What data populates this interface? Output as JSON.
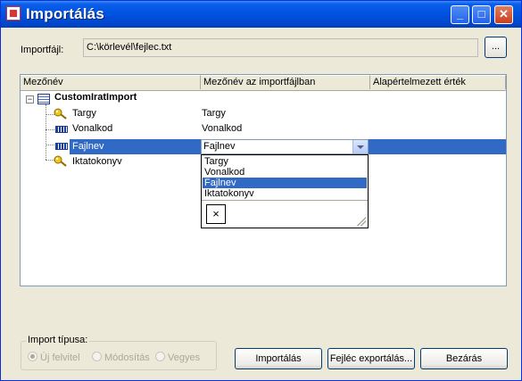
{
  "window": {
    "title": "Importálás"
  },
  "titlebar_buttons": {
    "minimize": "_",
    "maximize": "□",
    "close": "✕"
  },
  "import_file": {
    "label": "Importfájl:",
    "value": "C:\\körlevél\\fejlec.txt",
    "browse_label": "..."
  },
  "grid": {
    "columns": [
      "Mezőnév",
      "Mezőnév az importfájlban",
      "Alapértelmezett érték"
    ],
    "root": "CustomIratImport",
    "rows": [
      {
        "name": "Targy",
        "icon": "key-icon",
        "import_name": "Targy"
      },
      {
        "name": "Vonalkod",
        "icon": "field-icon",
        "import_name": "Vonalkod"
      },
      {
        "name": "Fajlnev",
        "icon": "field-icon",
        "import_name": "Fajlnev",
        "selected": true
      },
      {
        "name": "Iktatokonyv",
        "icon": "key-icon",
        "import_name": ""
      }
    ],
    "dropdown_options": [
      "Targy",
      "Vonalkod",
      "Fajlnev",
      "Iktatokonyv"
    ],
    "dropdown_selected": "Fajlnev",
    "dropdown_clear": "×"
  },
  "import_type": {
    "legend": "Import típusa:",
    "options": [
      "Új felvitel",
      "Módosítás",
      "Vegyes"
    ],
    "selected": "Új felvitel"
  },
  "buttons": {
    "import": "Importálás",
    "export_header": "Fejléc exportálás...",
    "close": "Bezárás"
  },
  "colors": {
    "title_bar": "#0054e3",
    "selection": "#316ac5",
    "dialog_bg": "#ece9d8"
  }
}
